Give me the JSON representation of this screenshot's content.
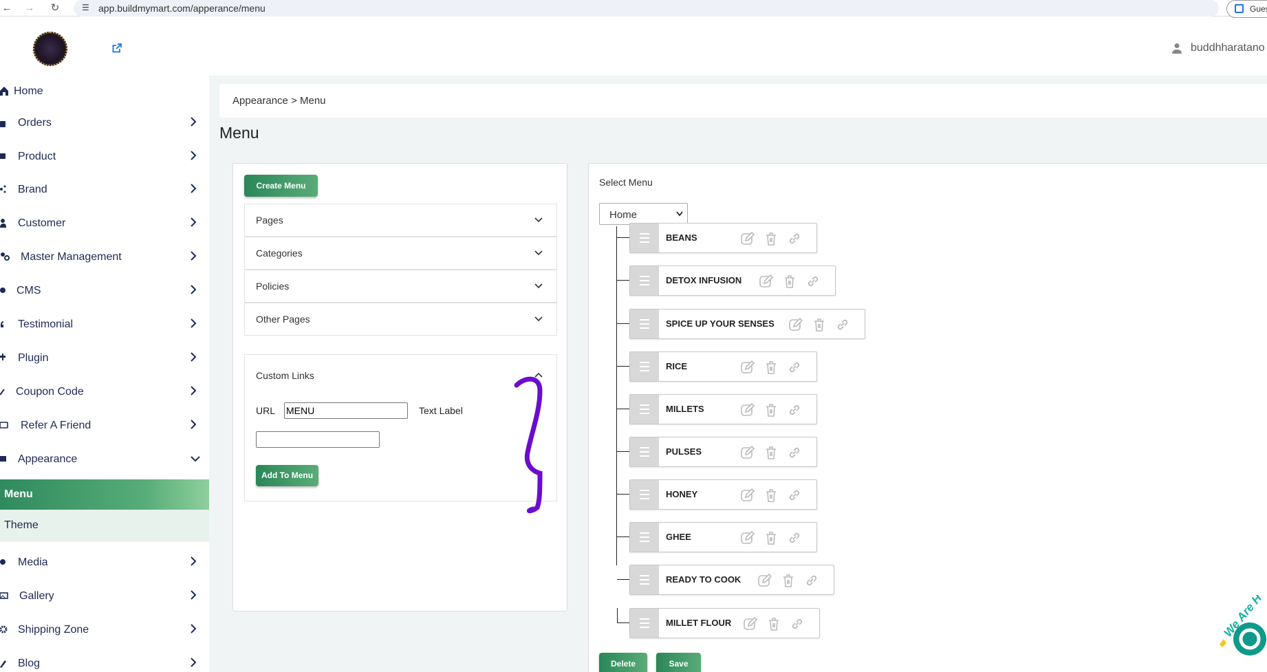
{
  "browser": {
    "url": "app.buildmymart.com/apperance/menu",
    "profile_label": "Gues"
  },
  "header": {
    "user_name": "buddhharatano"
  },
  "sidebar": {
    "items": [
      {
        "label": "Home"
      },
      {
        "label": "Orders"
      },
      {
        "label": "Product"
      },
      {
        "label": "Brand"
      },
      {
        "label": "Customer"
      },
      {
        "label": "Master Management"
      },
      {
        "label": "CMS"
      },
      {
        "label": "Testimonial"
      },
      {
        "label": "Plugin"
      },
      {
        "label": "Coupon Code"
      },
      {
        "label": "Refer A Friend"
      },
      {
        "label": "Appearance"
      },
      {
        "label": "Menu"
      },
      {
        "label": "Theme"
      },
      {
        "label": "Media"
      },
      {
        "label": "Gallery"
      },
      {
        "label": "Shipping Zone"
      },
      {
        "label": "Blog"
      }
    ]
  },
  "breadcrumb": "Appearance > Menu",
  "page_title": "Menu",
  "left_panel": {
    "create_menu_label": "Create Menu",
    "accordions": [
      {
        "label": "Pages"
      },
      {
        "label": "Categories"
      },
      {
        "label": "Policies"
      },
      {
        "label": "Other Pages"
      }
    ],
    "custom_links": {
      "title": "Custom Links",
      "url_label": "URL",
      "url_value": "MENU",
      "text_label": "Text Label",
      "text_value": "",
      "add_button": "Add To Menu"
    }
  },
  "right_panel": {
    "select_label": "Select Menu",
    "selected_menu": "Home",
    "menu_items": [
      {
        "label": "BEANS"
      },
      {
        "label": "DETOX INFUSION"
      },
      {
        "label": "SPICE UP YOUR SENSES"
      },
      {
        "label": "RICE"
      },
      {
        "label": "MILLETS"
      },
      {
        "label": "PULSES"
      },
      {
        "label": "HONEY"
      },
      {
        "label": "GHEE"
      },
      {
        "label": "READY TO COOK"
      },
      {
        "label": "MILLET FLOUR"
      }
    ],
    "delete_label": "Delete",
    "save_label": "Save"
  },
  "chat_widget": {
    "text": "We Are H"
  },
  "colors": {
    "accent_green": "#2b8659",
    "accent_green_light": "#5aac78",
    "sidebar_text": "#1e2a55",
    "annotation": "#6a0dcf"
  }
}
